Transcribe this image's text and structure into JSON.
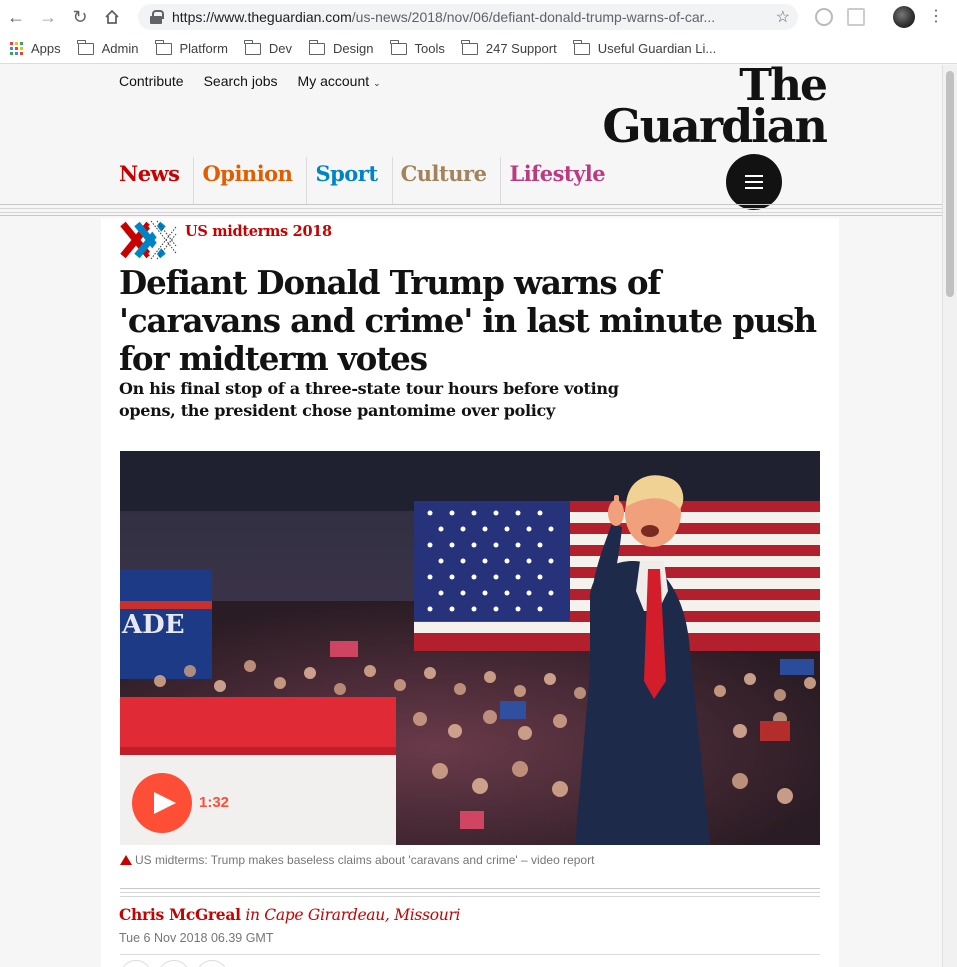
{
  "browser": {
    "url_main": "https://www.theguardian.com",
    "url_rest": "/us-news/2018/nov/06/defiant-donald-trump-warns-of-car...",
    "bookmarks": [
      {
        "label": "Apps",
        "icon": "apps-grid-icon"
      },
      {
        "label": "Admin",
        "icon": "folder-icon"
      },
      {
        "label": "Platform",
        "icon": "folder-icon"
      },
      {
        "label": "Dev",
        "icon": "folder-icon"
      },
      {
        "label": "Design",
        "icon": "folder-icon"
      },
      {
        "label": "Tools",
        "icon": "folder-icon"
      },
      {
        "label": "247 Support",
        "icon": "folder-icon"
      },
      {
        "label": "Useful Guardian Li...",
        "icon": "folder-icon"
      }
    ]
  },
  "header": {
    "links": [
      "Contribute",
      "Search jobs",
      "My account"
    ],
    "logo_line1": "The",
    "logo_line2": "Guardian",
    "pillars": [
      {
        "label": "News",
        "color": "#c70000"
      },
      {
        "label": "Opinion",
        "color": "#e05e00"
      },
      {
        "label": "Sport",
        "color": "#0084c6"
      },
      {
        "label": "Culture",
        "color": "#a1845c"
      },
      {
        "label": "Lifestyle",
        "color": "#bb3b80"
      }
    ]
  },
  "article": {
    "kicker": "US midterms 2018",
    "headline": "Defiant Donald Trump warns of 'caravans and crime' in last minute push for midterm votes",
    "standfirst": "On his final stop of a three-state tour hours before voting opens, the president chose pantomime over policy",
    "video_duration": "1:32",
    "caption": "US midterms: Trump makes baseless claims about 'caravans and crime' – video report",
    "byline_name": "Chris McGreal",
    "byline_location": "in Cape Girardeau, Missouri",
    "dateline": "Tue 6 Nov 2018 06.39 GMT"
  },
  "colors": {
    "news_red": "#c70000",
    "play_orange": "#ff4e36"
  }
}
